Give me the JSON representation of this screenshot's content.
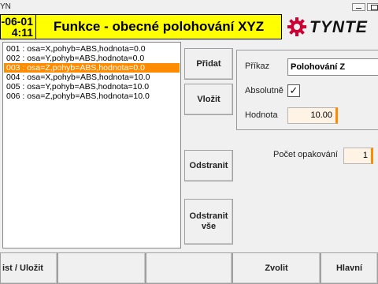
{
  "window": {
    "title": "YN"
  },
  "header": {
    "date": "-06-01",
    "time": "4:11",
    "title": "Funkce - obecné polohování XYZ",
    "logo_text": "TYNTE",
    "logo_color": "#cc0033"
  },
  "list": {
    "items": [
      "001 : osa=X,pohyb=ABS,hodnota=0.0",
      "002 : osa=Y,pohyb=ABS,hodnota=0.0",
      "003 : osa=Z,pohyb=ABS,hodnota=0.0",
      "004 : osa=X,pohyb=ABS,hodnota=10.0",
      "005 : osa=Y,pohyb=ABS,hodnota=10.0",
      "006 : osa=Z,pohyb=ABS,hodnota=10.0"
    ],
    "selected_index": 2
  },
  "actions": {
    "add": "Přidat",
    "insert": "Vložit",
    "remove": "Odstranit",
    "remove_all_line1": "Odstranit",
    "remove_all_line2": "vše"
  },
  "command_panel": {
    "command_label": "Příkaz",
    "command_value": "Polohování Z",
    "absolute_label": "Absolutně",
    "absolute_checked": true,
    "check_glyph": "✓",
    "value_label": "Hodnota",
    "value": "10.00"
  },
  "repeat": {
    "label": "Počet opakování",
    "value": "1"
  },
  "footer": {
    "b1": "ist  /  Uložit",
    "b2": "",
    "b3": "",
    "b4": "Zvolit",
    "b5": "Hlavní"
  },
  "colors": {
    "title_bg": "#ffff00",
    "selection": "#ff8c00",
    "numeric_bg": "#fff3e6"
  }
}
